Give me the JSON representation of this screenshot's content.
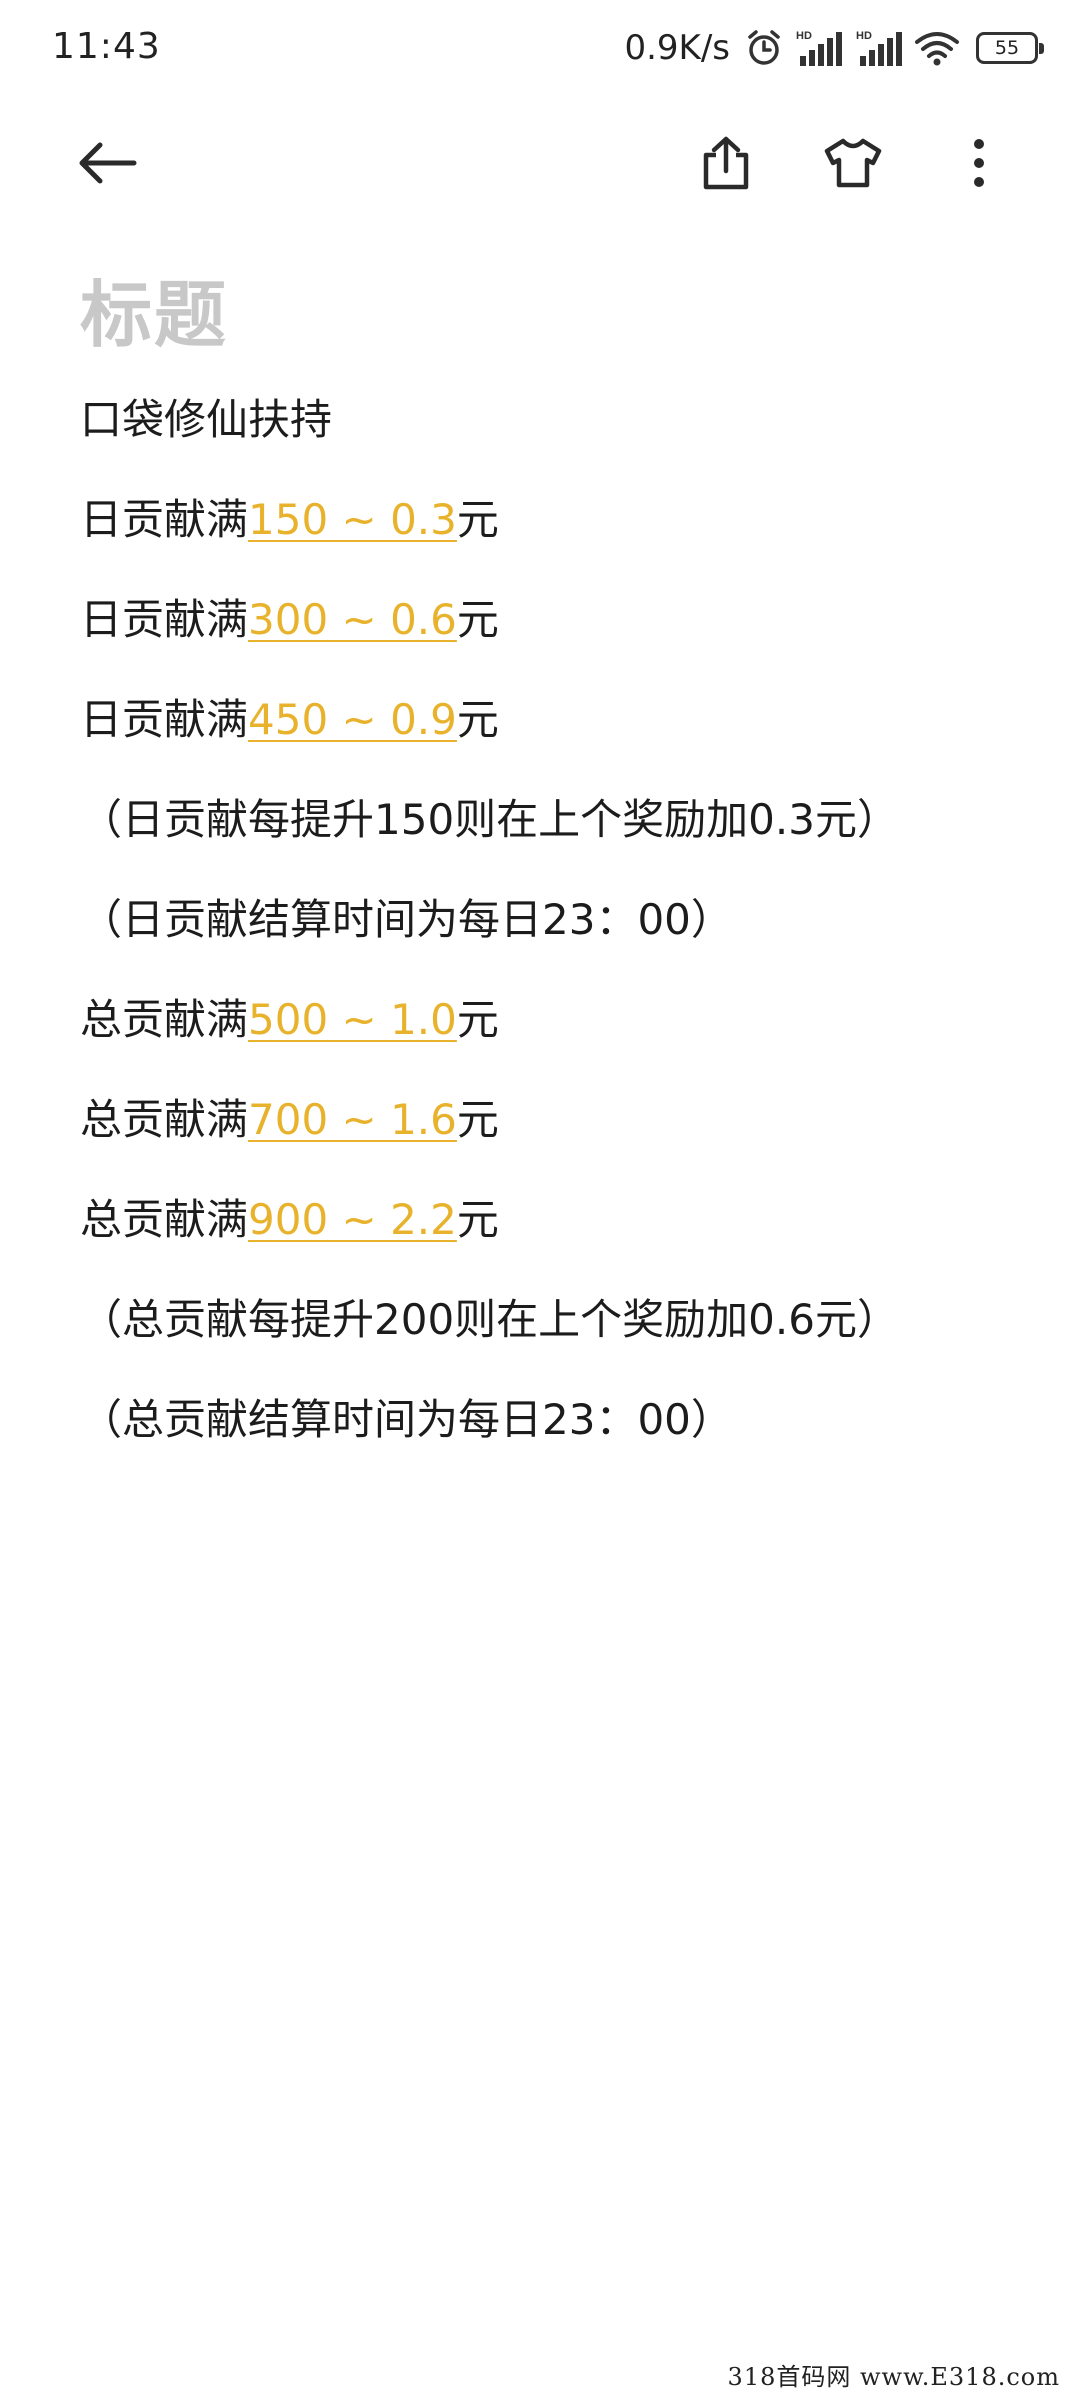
{
  "status_bar": {
    "time": "11:43",
    "net_speed": "0.9K/s",
    "battery_level": "55",
    "icons": [
      "alarm-icon",
      "signal-hd-icon",
      "signal-hd-icon",
      "wifi-icon",
      "battery-icon"
    ]
  },
  "toolbar": {
    "icons": [
      "back-arrow-icon",
      "share-icon",
      "tshirt-icon",
      "more-vertical-icon"
    ]
  },
  "note": {
    "title_placeholder": "标题",
    "heading": "口袋修仙扶持",
    "daily": [
      {
        "prefix": "日贡献满",
        "link": "150 ~ 0.3",
        "suffix": "元"
      },
      {
        "prefix": "日贡献满",
        "link": "300 ~ 0.6",
        "suffix": "元"
      },
      {
        "prefix": "日贡献满",
        "link": "450 ~ 0.9",
        "suffix": "元"
      }
    ],
    "daily_note_1": "（日贡献每提升150则在上个奖励加0.3元）",
    "daily_note_2": "（日贡献结算时间为每日23：00）",
    "total": [
      {
        "prefix": "总贡献满",
        "link": "500 ~ 1.0",
        "suffix": "元"
      },
      {
        "prefix": "总贡献满",
        "link": "700 ~ 1.6",
        "suffix": "元"
      },
      {
        "prefix": "总贡献满",
        "link": "900 ~ 2.2",
        "suffix": "元"
      }
    ],
    "total_note_1": "（总贡献每提升200则在上个奖励加0.6元）",
    "total_note_2": "（总贡献结算时间为每日23：00）"
  },
  "watermark": "318首码网 www.E318.com",
  "colors": {
    "link": "#e8b22c",
    "title_placeholder": "#c8c8c8",
    "text": "#1c1c1c"
  }
}
